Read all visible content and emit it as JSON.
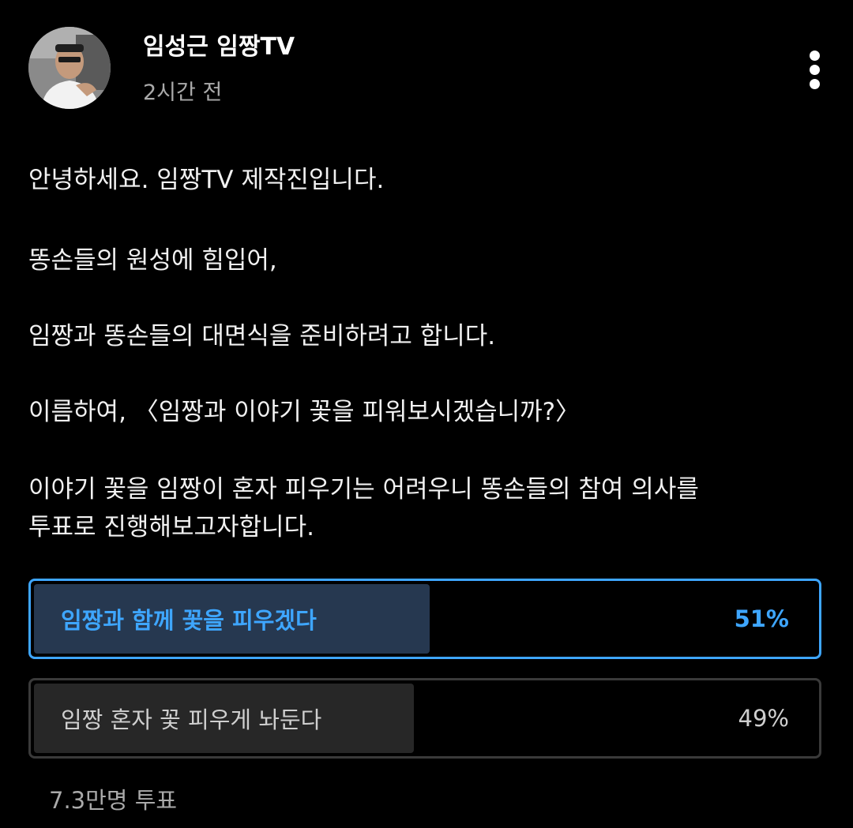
{
  "post": {
    "author": "임성근 임짱TV",
    "time": "2시간 전",
    "paragraphs": [
      "안녕하세요. 임짱TV 제작진입니다.",
      "똥손들의 원성에 힘입어,",
      "임짱과 똥손들의 대면식을 준비하려고 합니다.",
      "이름하여, 〈임짱과 이야기 꽃을 피워보시겠습니까?〉",
      "이야기 꽃을 임짱이 혼자 피우기는 어려우니 똥손들의 참여 의사를",
      "투표로 진행해보고자합니다."
    ]
  },
  "poll": {
    "options": [
      {
        "label": "임짱과 함께 꽃을 피우겠다",
        "percent_text": "51%",
        "share": 0.51,
        "selected": true
      },
      {
        "label": "임짱 혼자 꽃 피우게 놔둔다",
        "percent_text": "49%",
        "share": 0.49,
        "selected": false
      }
    ],
    "votes": "7.3만명 투표"
  },
  "colors": {
    "background": "#000000",
    "accent": "#3ea6ff",
    "selected_fill": "#263850",
    "unselected_fill": "#272727",
    "muted_text": "#aaaaaa"
  },
  "icons": {
    "menu": "more-vertical-icon",
    "avatar": "channel-avatar"
  }
}
